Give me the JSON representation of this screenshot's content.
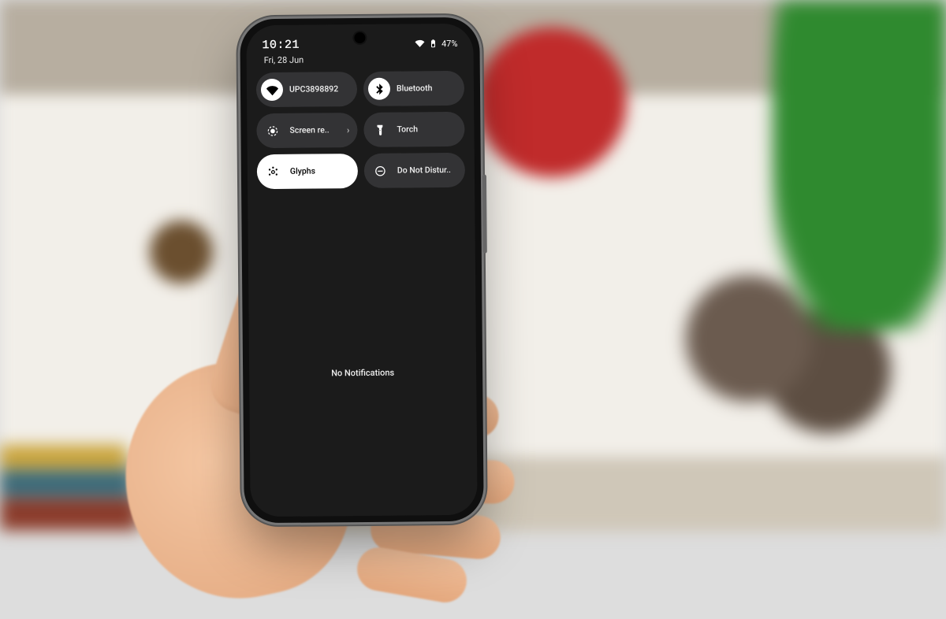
{
  "statusbar": {
    "time": "10:21",
    "date": "Fri, 28 Jun",
    "battery_text": "47%"
  },
  "tiles": {
    "wifi": {
      "label": "UPC3898892"
    },
    "bluetooth": {
      "label": "Bluetooth"
    },
    "screenrec": {
      "label": "Screen re.."
    },
    "torch": {
      "label": "Torch"
    },
    "glyphs": {
      "label": "Glyphs"
    },
    "dnd": {
      "label": "Do Not Distur.."
    }
  },
  "body": {
    "no_notifications": "No Notifications"
  }
}
